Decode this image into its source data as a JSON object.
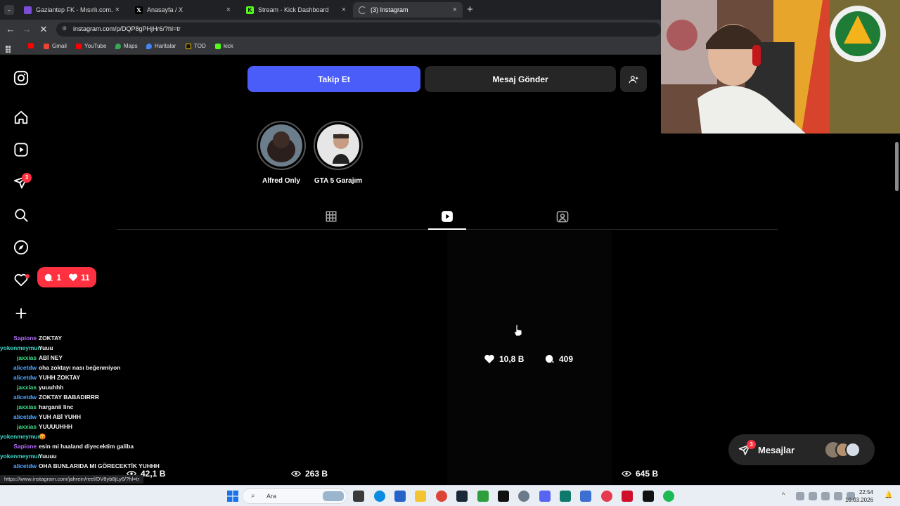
{
  "browser": {
    "tabs": [
      {
        "title": "Gaziantep FK - Mısırlı.com.tr Fa",
        "active": false,
        "favicon_color": "#7b4dd6"
      },
      {
        "title": "Anasayfa / X",
        "active": false,
        "favicon_color": "#000000"
      },
      {
        "title": "Stream - Kick Dashboard",
        "active": false,
        "favicon_color": "#53fc18"
      },
      {
        "title": "(3) Instagram",
        "active": true,
        "favicon_color": "#888888"
      }
    ],
    "url": "instagram.com/p/DQP8gPHjHr6/?hl=tr",
    "bookmarks": [
      {
        "label": "Gmail",
        "color": "#ea4335"
      },
      {
        "label": "YouTube",
        "color": "#ff0000"
      },
      {
        "label": "Maps",
        "color": "#34a853"
      },
      {
        "label": "Haritalar",
        "color": "#4285f4"
      },
      {
        "label": "TOD",
        "color": "#111111"
      },
      {
        "label": "kick",
        "color": "#53fc18"
      }
    ],
    "status_url": "https://www.instagram.com/jahrein/reel/DV8yb8jLy6/?hl=tr"
  },
  "instagram": {
    "notifications_badge": "3",
    "follow_label": "Takip Et",
    "message_label": "Mesaj Gönder",
    "highlights": [
      {
        "label": "Alfred Only"
      },
      {
        "label": "GTA 5 Garajım"
      }
    ],
    "notif_pill": {
      "comments": "1",
      "likes": "11"
    },
    "reel": {
      "likes": "10,8 B",
      "comments": "409"
    },
    "views": [
      {
        "value": "42,1 B"
      },
      {
        "value": "263 B"
      },
      {
        "value": "645 B"
      }
    ],
    "messages": {
      "label": "Mesajlar",
      "badge": "3"
    }
  },
  "chat": [
    {
      "user": "Sapione",
      "color": "#b46cff",
      "msg": "ZOKTAY"
    },
    {
      "user": "yokenmeymun",
      "color": "#3fd6c9",
      "msg": "Yuuu"
    },
    {
      "user": "jaxxias",
      "color": "#3ee08a",
      "msg": "ABİ NEY"
    },
    {
      "user": "alicetdw",
      "color": "#52a6ff",
      "msg": "oha zoktayı nası beğenmiyon"
    },
    {
      "user": "alicetdw",
      "color": "#52a6ff",
      "msg": "YUHH ZOKTAY"
    },
    {
      "user": "jaxxias",
      "color": "#3ee08a",
      "msg": "yuuuhhh"
    },
    {
      "user": "alicetdw",
      "color": "#52a6ff",
      "msg": "ZOKTAY BABADIRRR"
    },
    {
      "user": "jaxxias",
      "color": "#3ee08a",
      "msg": "harganii linc"
    },
    {
      "user": "alicetdw",
      "color": "#52a6ff",
      "msg": "YUH ABİ YUHH"
    },
    {
      "user": "jaxxias",
      "color": "#3ee08a",
      "msg": "YUUUUHHH"
    },
    {
      "user": "yokenmeymun",
      "color": "#3fd6c9",
      "msg": "😡"
    },
    {
      "user": "Sapione",
      "color": "#b46cff",
      "msg": "esin mi haaland diyecektim galiba"
    },
    {
      "user": "yokenmeymun",
      "color": "#3fd6c9",
      "msg": "Yuuuu"
    },
    {
      "user": "alicetdw",
      "color": "#52a6ff",
      "msg": "OHA BUNLARIDA MI GÖRECEKTİK YUHHH"
    }
  ],
  "taskbar": {
    "search_placeholder": "Ara",
    "time": "22:54",
    "date": "10.03.2026"
  }
}
